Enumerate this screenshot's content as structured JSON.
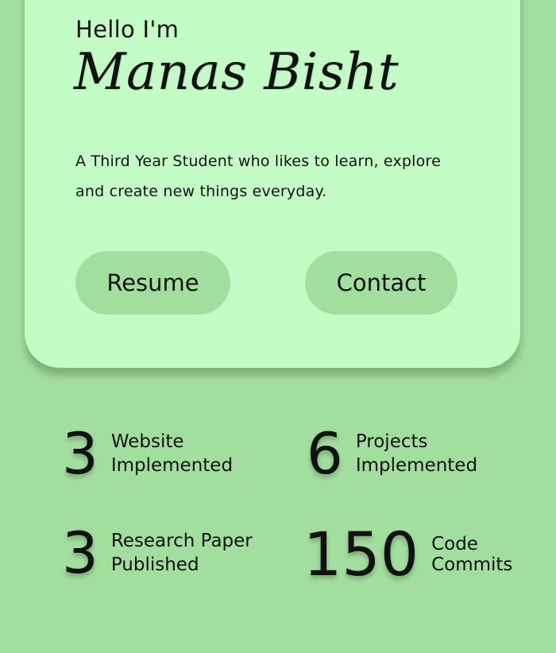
{
  "hero": {
    "greeting": "Hello I'm",
    "name": "Manas Bisht",
    "bio": "A Third Year Student who likes to learn, explore and create new things everyday.",
    "buttons": {
      "resume": "Resume",
      "contact": "Contact"
    }
  },
  "stats": [
    {
      "number": "3",
      "label": "Website\nImplemented"
    },
    {
      "number": "6",
      "label": "Projects\nImplemented"
    },
    {
      "number": "3",
      "label": "Research Paper\nPublished"
    },
    {
      "number": "150",
      "label": "Code\nCommits"
    }
  ],
  "colors": {
    "page_bg": "#a2de9d",
    "card_bg": "#c3fcc4",
    "button_bg": "#a2de9d"
  }
}
